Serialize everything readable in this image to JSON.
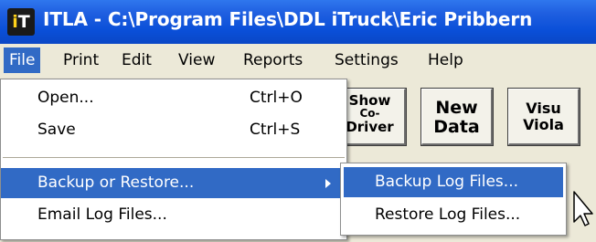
{
  "window": {
    "icon_text_left": "i",
    "icon_text_right": "T",
    "title": "ITLA - C:\\Program Files\\DDL iTruck\\Eric Pribbern"
  },
  "menubar": {
    "items": [
      "File",
      "Print",
      "Edit",
      "View",
      "Reports",
      "Settings",
      "Help"
    ],
    "active": "File"
  },
  "toolbar": {
    "buttons": [
      {
        "lines": [
          "Show",
          "Co-",
          "Driver"
        ]
      },
      {
        "lines": [
          "New",
          "Data"
        ]
      },
      {
        "lines": [
          "Visu",
          "Viola"
        ]
      }
    ]
  },
  "file_menu": {
    "open": {
      "label": "Open...",
      "shortcut": "Ctrl+O"
    },
    "save": {
      "label": "Save",
      "shortcut": "Ctrl+S"
    },
    "backup_restore": {
      "label": "Backup or Restore..."
    },
    "email": {
      "label": "Email Log Files..."
    }
  },
  "submenu": {
    "backup": {
      "label": "Backup Log Files..."
    },
    "restore": {
      "label": "Restore Log Files..."
    }
  },
  "colors": {
    "titlebar": "#0a4fd8",
    "highlight": "#316ac5",
    "menu_bg": "#ece9d8"
  }
}
